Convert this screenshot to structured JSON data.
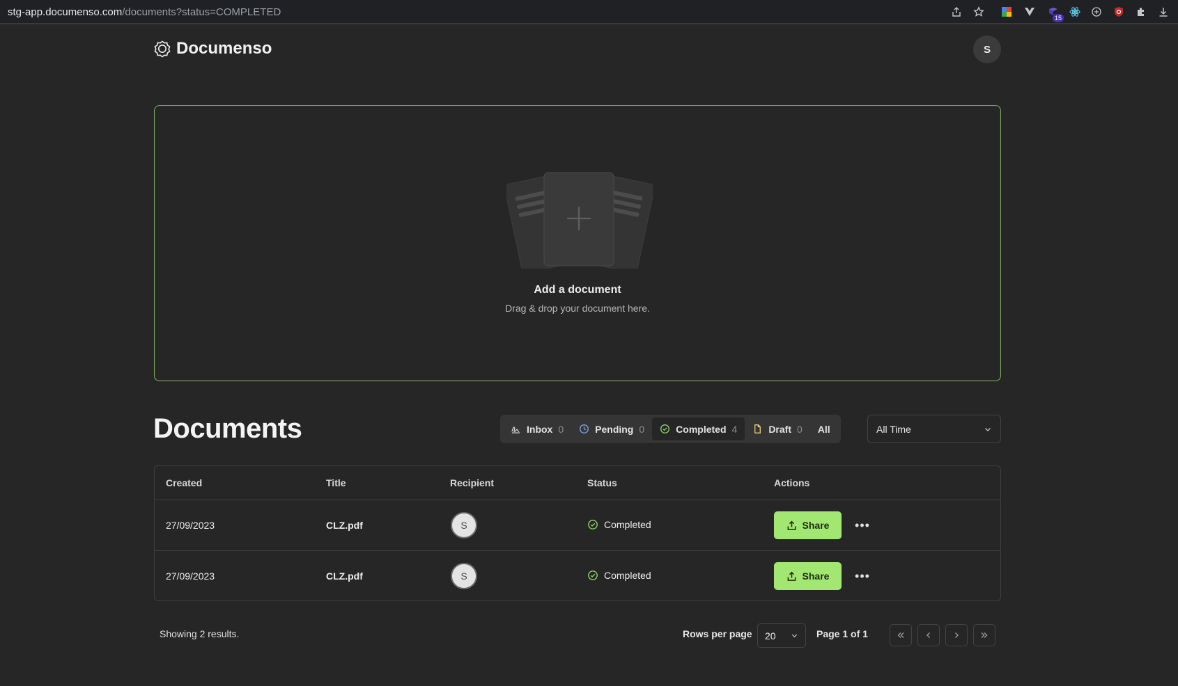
{
  "browser": {
    "url_host": "stg-app.documenso.com",
    "url_path": "/documents?status=COMPLETED",
    "extension_badge": "15"
  },
  "header": {
    "app_name": "Documenso",
    "user_initial": "S"
  },
  "dropzone": {
    "title": "Add a document",
    "subtitle": "Drag & drop your document here."
  },
  "documents": {
    "title": "Documents",
    "tabs": [
      {
        "label": "Inbox",
        "count": "0",
        "icon": "inbox-signature-icon"
      },
      {
        "label": "Pending",
        "count": "0",
        "icon": "clock-icon"
      },
      {
        "label": "Completed",
        "count": "4",
        "icon": "check-circle-icon",
        "active": true
      },
      {
        "label": "Draft",
        "count": "0",
        "icon": "file-icon"
      },
      {
        "label": "All",
        "count": ""
      }
    ],
    "period": "All Time"
  },
  "table": {
    "columns": [
      "Created",
      "Title",
      "Recipient",
      "Status",
      "Actions"
    ],
    "rows": [
      {
        "created": "27/09/2023",
        "title": "CLZ.pdf",
        "recipient": "S",
        "status": "Completed",
        "action": "Share"
      },
      {
        "created": "27/09/2023",
        "title": "CLZ.pdf",
        "recipient": "S",
        "status": "Completed",
        "action": "Share"
      }
    ]
  },
  "pagination": {
    "results_text": "Showing 2 results.",
    "rows_per_page_label": "Rows per page",
    "rows_per_page": "20",
    "page_info": "Page 1 of 1"
  },
  "colors": {
    "accent": "#a2e771",
    "dropzone_border": "#7fae5e",
    "background": "#262626"
  }
}
